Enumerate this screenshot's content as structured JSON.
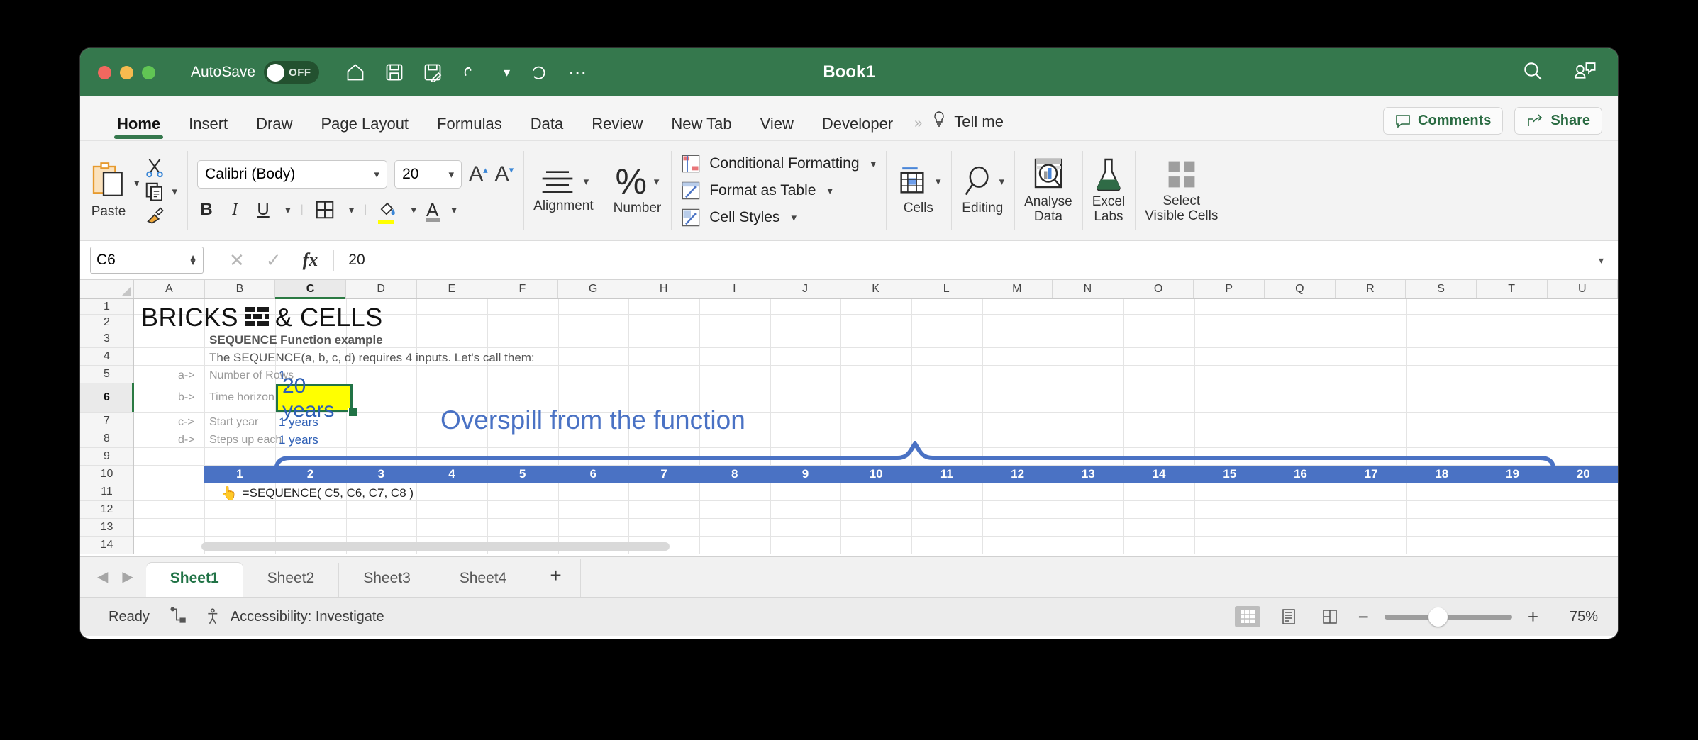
{
  "window": {
    "title": "Book1",
    "autosave_label": "AutoSave",
    "autosave_state": "OFF",
    "quick_access": [
      "home-icon",
      "save-icon",
      "save-as-icon",
      "undo-icon",
      "undo-dropdown",
      "redo-icon",
      "more-icon"
    ],
    "right_icons": [
      "search-icon",
      "account-comment-icon"
    ]
  },
  "ribbon": {
    "tabs": [
      {
        "label": "Home",
        "active": true
      },
      {
        "label": "Insert",
        "active": false
      },
      {
        "label": "Draw",
        "active": false
      },
      {
        "label": "Page Layout",
        "active": false
      },
      {
        "label": "Formulas",
        "active": false
      },
      {
        "label": "Data",
        "active": false
      },
      {
        "label": "Review",
        "active": false
      },
      {
        "label": "New Tab",
        "active": false
      },
      {
        "label": "View",
        "active": false
      },
      {
        "label": "Developer",
        "active": false
      }
    ],
    "overflow_chevrons": "»",
    "tell_me": "Tell me",
    "comments_label": "Comments",
    "share_label": "Share",
    "groups": {
      "paste_label": "Paste",
      "font_name": "Calibri (Body)",
      "font_size": "20",
      "bold": "B",
      "italic": "I",
      "underline": "U",
      "alignment_label": "Alignment",
      "number_label": "Number",
      "conditional_formatting": "Conditional Formatting",
      "format_as_table": "Format as Table",
      "cell_styles": "Cell Styles",
      "cells_label": "Cells",
      "editing_label": "Editing",
      "analyse_data_label": "Analyse\nData",
      "analyse_data_line1": "Analyse",
      "analyse_data_line2": "Data",
      "excel_labs_line1": "Excel",
      "excel_labs_line2": "Labs",
      "select_visible_line1": "Select",
      "select_visible_line2": "Visible Cells"
    }
  },
  "formula_bar": {
    "name_box": "C6",
    "cancel_icon": "✕",
    "confirm_icon": "✓",
    "fx_icon": "fx",
    "value": "20"
  },
  "grid": {
    "columns": [
      "A",
      "B",
      "C",
      "D",
      "E",
      "F",
      "G",
      "H",
      "I",
      "J",
      "K",
      "L",
      "M",
      "N",
      "O",
      "P",
      "Q",
      "R",
      "S",
      "T",
      "U"
    ],
    "selected_column": "C",
    "rows": [
      "1",
      "2",
      "3",
      "4",
      "5",
      "6",
      "7",
      "8",
      "9",
      "10",
      "11",
      "12",
      "13",
      "14"
    ],
    "selected_row": "6",
    "content": {
      "title_part1": "BRICKS",
      "title_part2": "& CELLS",
      "brick_icon_name": "brick-wall-icon",
      "subtitle": "SEQUENCE Function example",
      "description": "The SEQUENCE(a, b, c, d) requires 4 inputs. Let's call them:",
      "params": [
        {
          "key": "a->",
          "label": "Number of Rows",
          "value": "1"
        },
        {
          "key": "b->",
          "label": "Time horizon",
          "value": "20 years"
        },
        {
          "key": "c->",
          "label": "Start year",
          "value": "1 years"
        },
        {
          "key": "d->",
          "label": "Steps up each",
          "value": "1 years"
        }
      ],
      "annotation": "Overspill from the function",
      "spill_values": [
        "1",
        "2",
        "3",
        "4",
        "5",
        "6",
        "7",
        "8",
        "9",
        "10",
        "11",
        "12",
        "13",
        "14",
        "15",
        "16",
        "17",
        "18",
        "19",
        "20"
      ],
      "formula_note_icon": "👆",
      "formula_note": "=SEQUENCE( C5, C6, C7, C8 )"
    }
  },
  "sheet_tabs": {
    "tabs": [
      {
        "label": "Sheet1",
        "active": true
      },
      {
        "label": "Sheet2",
        "active": false
      },
      {
        "label": "Sheet3",
        "active": false
      },
      {
        "label": "Sheet4",
        "active": false
      }
    ],
    "add_label": "+"
  },
  "status_bar": {
    "state": "Ready",
    "accessibility": "Accessibility: Investigate",
    "zoom": "75%",
    "zoom_minus": "−",
    "zoom_plus": "+",
    "view_buttons": [
      "normal-view-icon",
      "page-layout-icon",
      "page-break-icon"
    ]
  },
  "colors": {
    "ribbon_green": "#35784d",
    "spill_blue": "#4a72c4",
    "selection_green": "#217346",
    "highlight_yellow": "#ffff00"
  }
}
